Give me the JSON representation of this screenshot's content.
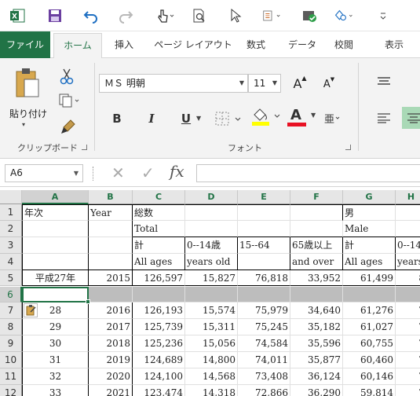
{
  "qat": {
    "icons": [
      "excel-logo-icon",
      "save-icon",
      "undo-icon",
      "redo-icon",
      "touch-mode-icon",
      "print-preview-icon",
      "select-pointer-icon",
      "sort-icon",
      "check-icon",
      "shapes-icon",
      "customize-icon"
    ]
  },
  "tabs": [
    "ファイル",
    "ホーム",
    "挿入",
    "ページ レイアウト",
    "数式",
    "データ",
    "校閲",
    "表示"
  ],
  "ribbon": {
    "clipboard": {
      "paste_label": "貼り付け",
      "group_label": "クリップボード"
    },
    "font": {
      "font_name": "ＭＳ 明朝",
      "font_size": "11",
      "grow_label": "A",
      "shrink_label": "A",
      "bold_label": "B",
      "italic_label": "I",
      "underline_label": "U",
      "font_color_label": "A",
      "font_color": "#e81123",
      "highlight_color": "#ffff00",
      "group_label": "フォント"
    }
  },
  "formula_bar": {
    "name_box": "A6",
    "cancel_label": "✕",
    "enter_label": "✓",
    "fx_label": "fx",
    "value": ""
  },
  "grid": {
    "columns": [
      "A",
      "B",
      "C",
      "D",
      "E",
      "F",
      "G",
      "H"
    ],
    "rows": [
      "1",
      "2",
      "3",
      "4",
      "5",
      "6",
      "7",
      "8",
      "9",
      "10",
      "11",
      "12"
    ],
    "header": {
      "r1": {
        "a": "年次",
        "b": "Year",
        "c": "総数",
        "g": "男"
      },
      "r2": {
        "c": "Total",
        "g": "Male"
      },
      "r3": {
        "c": "計",
        "d": "0--14歳",
        "e": "15--64",
        "f": "65歳以上",
        "g": "計",
        "h": "0--14"
      },
      "r4": {
        "c": "All ages",
        "d": "years old",
        "f": "and over",
        "g": "All ages",
        "h": "years"
      }
    },
    "data_rows": [
      {
        "row": "5",
        "a": "平成27年",
        "b": "2015",
        "c": "126,597",
        "d": "15,827",
        "e": "76,818",
        "f": "33,952",
        "g": "61,499",
        "h": "8"
      },
      {
        "row": "7",
        "a": "28",
        "b": "2016",
        "c": "126,193",
        "d": "15,574",
        "e": "75,979",
        "f": "34,640",
        "g": "61,276",
        "h": "7"
      },
      {
        "row": "8",
        "a": "29",
        "b": "2017",
        "c": "125,739",
        "d": "15,311",
        "e": "75,245",
        "f": "35,182",
        "g": "61,027",
        "h": "7"
      },
      {
        "row": "9",
        "a": "30",
        "b": "2018",
        "c": "125,236",
        "d": "15,056",
        "e": "74,584",
        "f": "35,596",
        "g": "60,755",
        "h": "7"
      },
      {
        "row": "10",
        "a": "31",
        "b": "2019",
        "c": "124,689",
        "d": "14,800",
        "e": "74,011",
        "f": "35,877",
        "g": "60,460",
        "h": "7"
      },
      {
        "row": "11",
        "a": "32",
        "b": "2020",
        "c": "124,100",
        "d": "14,568",
        "e": "73,408",
        "f": "36,124",
        "g": "60,146",
        "h": "7"
      },
      {
        "row": "12",
        "a": "33",
        "b": "2021",
        "c": "123,474",
        "d": "14,318",
        "e": "72,866",
        "f": "36,290",
        "g": "59,814",
        "h": "7"
      }
    ],
    "selected_cell": "A6",
    "accent": "#217346"
  }
}
